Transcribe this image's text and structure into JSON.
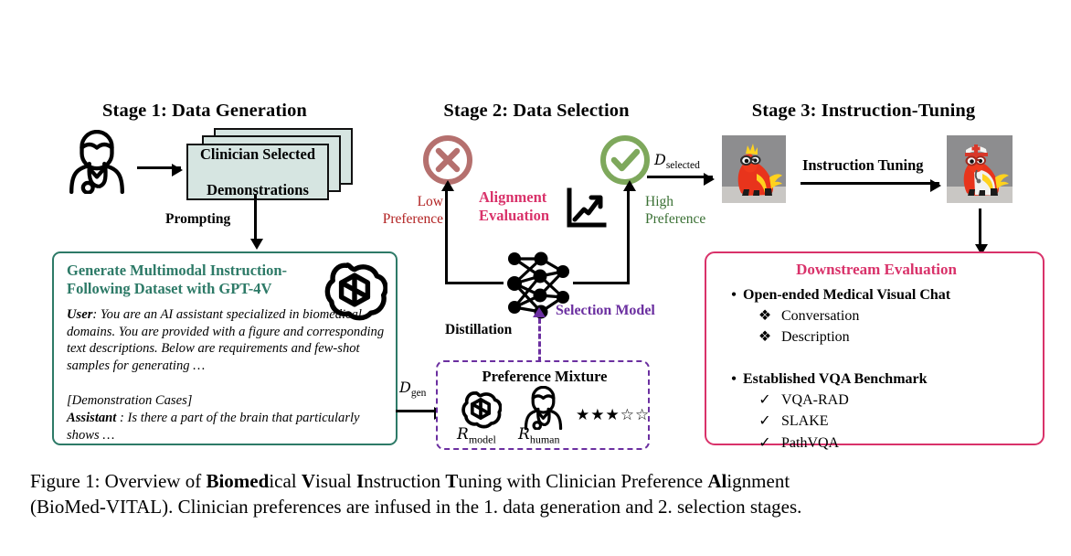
{
  "figure": {
    "caption_line1_pre": "Figure 1: Overview of ",
    "caption_b1": "Biomed",
    "caption_t1": "ical ",
    "caption_b2": "V",
    "caption_t2": "isual ",
    "caption_b3": "I",
    "caption_t3": "nstruction ",
    "caption_b4": "T",
    "caption_t4": "uning with Clinician Preference ",
    "caption_b5": "Al",
    "caption_t5": "ignment",
    "caption_line2": "(BioMed-VITAL). Clinician preferences are infused in the 1. data generation and 2. selection stages."
  },
  "stage1": {
    "title": "Stage 1: Data Generation",
    "clinician_icon": "doctor-icon",
    "papers_label": "Clinician Selected Demonstrations",
    "papers_line1": "Clinician Selected",
    "papers_line2": "Demonstrations",
    "prompting_label": "Prompting",
    "prompt_box": {
      "heading_line1": "Generate Multimodal Instruction-",
      "heading_line2": "Following Dataset with GPT-4V",
      "logo": "openai-logo-icon",
      "user_role": "User",
      "user_text": ": You are an AI assistant specialized in biomedical domains. You are provided with a figure and corresponding text descriptions. Below are requirements and few-shot samples for generating …",
      "demo_cases": "[Demonstration Cases]",
      "assistant_role": "Assistant",
      "assistant_text": " : Is there a part of the brain that particularly shows …"
    },
    "d_gen_symbol": "D",
    "d_gen_sub": "gen"
  },
  "stage2": {
    "title": "Stage 2: Data Selection",
    "reject_icon": "circle-cross-icon",
    "accept_icon": "circle-check-icon",
    "low_pref_line1": "Low",
    "low_pref_line2": "Preference",
    "high_pref_line1": "High",
    "high_pref_line2": "Preference",
    "alignment_line1": "Alignment",
    "alignment_line2": "Evaluation",
    "chart_icon": "trending-up-chart-icon",
    "selection_model_label": "Selection Model",
    "network_icon": "neural-network-icon",
    "distillation_label": "Distillation",
    "d_selected_symbol": "D",
    "d_selected_sub": "selected",
    "preference_box": {
      "title": "Preference Mixture",
      "model_logo": "openai-logo-icon",
      "model_label_symbol": "R",
      "model_label_sub": "model",
      "human_icon": "doctor-icon",
      "human_label_symbol": "R",
      "human_label_sub": "human",
      "rating_stars": "★★★☆☆"
    }
  },
  "stage3": {
    "title": "Stage 3: Instruction-Tuning",
    "base_model_image": "llama-figurine-photo",
    "tuned_model_image": "llama-doctor-figurine-photo",
    "instruction_tuning_label": "Instruction Tuning",
    "eval_box": {
      "title": "Downstream Evaluation",
      "sections": [
        {
          "bullet": "•",
          "heading": "Open-ended Medical Visual Chat",
          "sub_marker": "❖",
          "items": [
            "Conversation",
            "Description"
          ]
        },
        {
          "bullet": "•",
          "heading": "Established VQA Benchmark",
          "sub_marker": "✓",
          "items": [
            "VQA-RAD",
            "SLAKE",
            "PathVQA"
          ]
        }
      ]
    }
  },
  "colors": {
    "teal": "#2d7a67",
    "pink": "#d9326a",
    "purple": "#6b2fa0",
    "red": "#b22222",
    "green": "#3a7034",
    "reject_rose": "#b5706e",
    "accept_green": "#7ea85c",
    "paper_fill": "#d6e5e1"
  }
}
